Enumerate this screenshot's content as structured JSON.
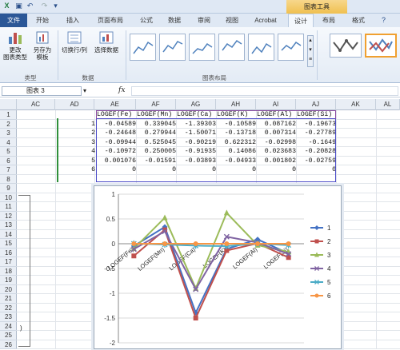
{
  "quick_access": {
    "save_icon": "save-icon",
    "undo_icon": "undo-icon",
    "redo_icon": "redo-icon"
  },
  "context_title": "图表工具",
  "tabs": [
    "文件",
    "开始",
    "插入",
    "页面布局",
    "公式",
    "数据",
    "审阅",
    "视图",
    "Acrobat",
    "设计",
    "布局",
    "格式"
  ],
  "active_tab": "设计",
  "ribbon": {
    "change_type": "更改\n图表类型",
    "save_template": "另存为\n模板",
    "switch_row_col": "切换行/列",
    "select_data": "选择数据",
    "group_type": "类型",
    "group_data": "数据",
    "group_layout": "图表布局"
  },
  "formula_bar": {
    "name_box": "图表 3",
    "fx": "fx"
  },
  "columns": [
    "AC",
    "AD",
    "AE",
    "AF",
    "AG",
    "AH",
    "AI",
    "AJ",
    "AK",
    "AL"
  ],
  "rows": [
    "1",
    "2",
    "3",
    "4",
    "5",
    "6",
    "7",
    "8",
    "9",
    "10",
    "11",
    "12",
    "13",
    "14",
    "15",
    "16",
    "17",
    "18",
    "19",
    "20",
    "21",
    "22",
    "23",
    "24",
    "25",
    "26"
  ],
  "table": {
    "headers": [
      "LOGEF(Fe)",
      "LOGEF(Mn)",
      "LOGEF(Ca)",
      "LOGEF(K)",
      "LOGEF(Al)",
      "LOGEF(Si)"
    ],
    "rows": [
      {
        "id": "1",
        "vals": [
          "-0.04589",
          "0.339045",
          "-1.39303",
          "-0.10589",
          "0.087162",
          "-0.19673"
        ]
      },
      {
        "id": "2",
        "vals": [
          "-0.24648",
          "0.279944",
          "-1.50071",
          "-0.13718",
          "0.007314",
          "-0.27789"
        ]
      },
      {
        "id": "3",
        "vals": [
          "-0.09944",
          "0.525045",
          "-0.90219",
          "0.622312",
          "-0.02998",
          "-0.1649"
        ]
      },
      {
        "id": "4",
        "vals": [
          "-0.10972",
          "0.250005",
          "-0.91935",
          "0.14086",
          "0.023683",
          "-0.20828"
        ]
      },
      {
        "id": "5",
        "vals": [
          "0.001076",
          "-0.01591",
          "-0.03893",
          "-0.04933",
          "0.001802",
          "-0.02759"
        ]
      },
      {
        "id": "6",
        "vals": [
          "0",
          "0",
          "0",
          "0",
          "0",
          "0"
        ]
      }
    ]
  },
  "side_label": ")",
  "chart_data": {
    "type": "line",
    "categories": [
      "LOGEF(Fe)",
      "LOGEF(Mn)",
      "LOGEF(Ca)",
      "LOGEF(K)",
      "LOGEF(Al)",
      "LOGEF(Si)"
    ],
    "ylim": [
      -2,
      1
    ],
    "yticks": [
      "1",
      "0.5",
      "0",
      "-0.5",
      "-1",
      "-1.5",
      "-2"
    ],
    "legend_position": "right",
    "grid": true,
    "series": [
      {
        "name": "1",
        "color": "#4472c4",
        "marker": "diamond",
        "values": [
          -0.04589,
          0.339045,
          -1.39303,
          -0.10589,
          0.087162,
          -0.19673
        ]
      },
      {
        "name": "2",
        "color": "#c0504d",
        "marker": "square",
        "values": [
          -0.24648,
          0.279944,
          -1.50071,
          -0.13718,
          0.007314,
          -0.27789
        ]
      },
      {
        "name": "3",
        "color": "#9bbb59",
        "marker": "triangle",
        "values": [
          -0.09944,
          0.525045,
          -0.90219,
          0.622312,
          -0.02998,
          -0.1649
        ]
      },
      {
        "name": "4",
        "color": "#8064a2",
        "marker": "x",
        "values": [
          -0.10972,
          0.250005,
          -0.91935,
          0.14086,
          0.023683,
          -0.20828
        ]
      },
      {
        "name": "5",
        "color": "#4bacc6",
        "marker": "star",
        "values": [
          0.001076,
          -0.01591,
          -0.03893,
          -0.04933,
          0.001802,
          -0.02759
        ]
      },
      {
        "name": "6",
        "color": "#f79646",
        "marker": "circle",
        "values": [
          0,
          0,
          0,
          0,
          0,
          0
        ]
      }
    ]
  }
}
